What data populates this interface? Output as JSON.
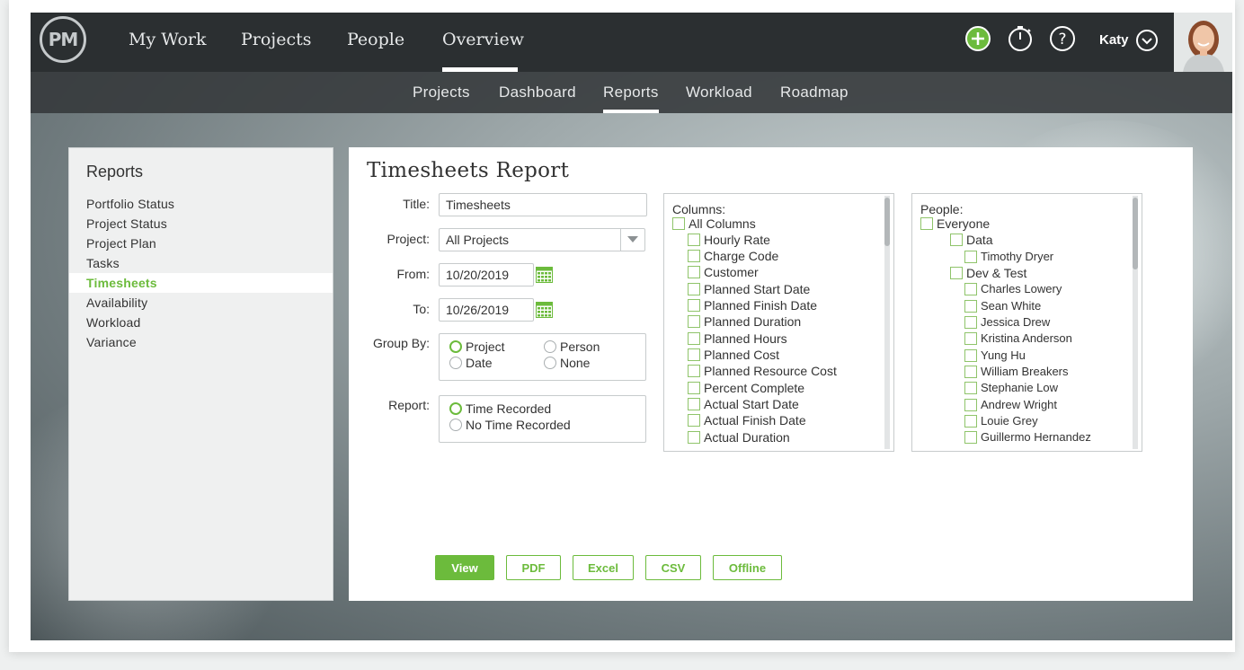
{
  "nav": {
    "logo": "PM",
    "items": [
      "My Work",
      "Projects",
      "People",
      "Overview"
    ],
    "user": "Katy"
  },
  "subnav": {
    "items": [
      "Projects",
      "Dashboard",
      "Reports",
      "Workload",
      "Roadmap"
    ]
  },
  "sidebar": {
    "title": "Reports",
    "items": [
      "Portfolio Status",
      "Project Status",
      "Project Plan",
      "Tasks",
      "Timesheets",
      "Availability",
      "Workload",
      "Variance"
    ],
    "active": "Timesheets"
  },
  "report": {
    "title": "Timesheets Report",
    "title_label": "Title:",
    "title_value": "Timesheets",
    "project_label": "Project:",
    "project_value": "All Projects",
    "from_label": "From:",
    "from_value": "10/20/2019",
    "to_label": "To:",
    "to_value": "10/26/2019",
    "group_by_label": "Group By:",
    "group_by_options": [
      "Project",
      "Person",
      "Date",
      "None"
    ],
    "group_by_selected": "Project",
    "report_label": "Report:",
    "report_options": [
      "Time Recorded",
      "No Time Recorded"
    ],
    "report_selected": "Time Recorded"
  },
  "columns": {
    "label": "Columns:",
    "all": "All Columns",
    "items": [
      "Hourly Rate",
      "Charge Code",
      "Customer",
      "Planned Start Date",
      "Planned Finish Date",
      "Planned Duration",
      "Planned Hours",
      "Planned Cost",
      "Planned Resource Cost",
      "Percent Complete",
      "Actual Start Date",
      "Actual Finish Date",
      "Actual Duration"
    ]
  },
  "people": {
    "label": "People:",
    "everyone": "Everyone",
    "groups": [
      {
        "name": "Data",
        "members": [
          "Timothy Dryer"
        ]
      },
      {
        "name": "Dev & Test",
        "members": [
          "Charles Lowery",
          "Sean White",
          "Jessica Drew",
          "Kristina Anderson",
          "Yung Hu",
          "William Breakers",
          "Stephanie Low",
          "Andrew Wright",
          "Louie Grey",
          "Guillermo Hernandez"
        ]
      }
    ]
  },
  "buttons": {
    "view": "View",
    "pdf": "PDF",
    "excel": "Excel",
    "csv": "CSV",
    "offline": "Offline"
  },
  "colors": {
    "accent": "#6cbb3c",
    "topbar": "#2b2f31"
  },
  "icons": [
    "add-icon",
    "timer-icon",
    "help-icon",
    "chevron-down-icon",
    "calendar-icon",
    "dropdown-arrow-icon"
  ]
}
